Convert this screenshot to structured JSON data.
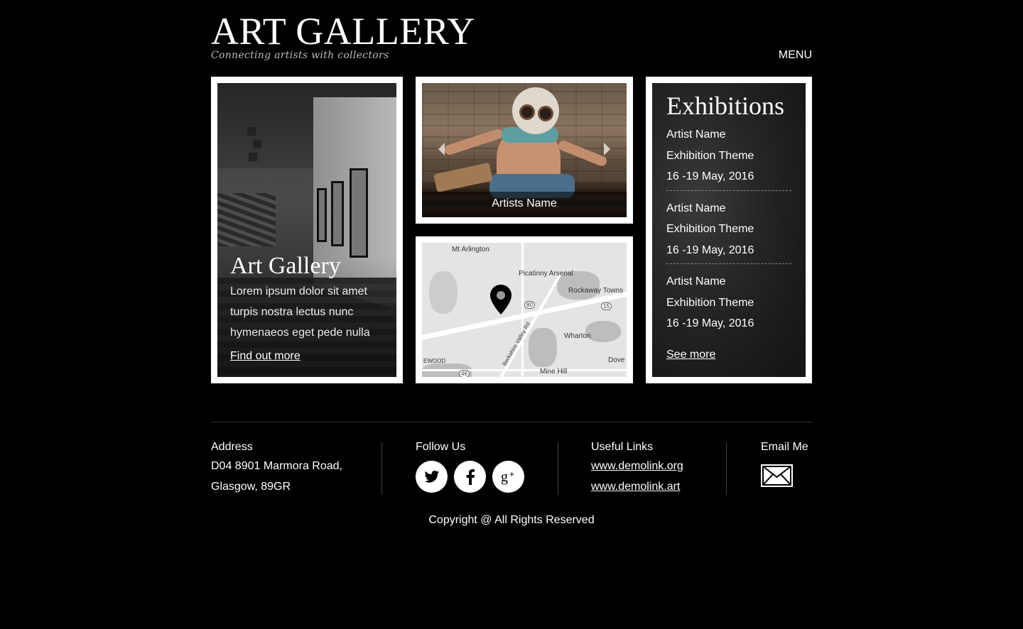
{
  "header": {
    "title": "ART GALLERY",
    "tagline": "Connecting artists with collectors",
    "menu_label": "MENU"
  },
  "gallery_card": {
    "title": "Art Gallery",
    "description": "Lorem ipsum dolor sit amet turpis nostra  lectus nunc hymenaeos eget pede nulla",
    "link_label": "Find out more"
  },
  "slider": {
    "caption": "Artists Name",
    "prev_icon": "chevron-left-icon",
    "next_icon": "chevron-right-icon"
  },
  "map": {
    "labels": {
      "mt_arlington": "Mt Arlington",
      "picatinny": "Picatinny Arsenal",
      "rockaway": "Rockaway Towns",
      "wharton": "Wharton",
      "berkshire": "Berkshire Valley Rd",
      "ewood": "EWOOD",
      "mine_hill": "Mine Hill",
      "dove": "Dove"
    },
    "shields": {
      "i80": "80",
      "r15": "15",
      "r46": "46"
    }
  },
  "exhibitions": {
    "title": "Exhibitions",
    "items": [
      {
        "artist": "Artist Name",
        "theme": "Exhibition Theme",
        "dates": "16 -19 May, 2016"
      },
      {
        "artist": "Artist Name",
        "theme": "Exhibition Theme",
        "dates": "16 -19 May, 2016"
      },
      {
        "artist": "Artist Name",
        "theme": "Exhibition Theme",
        "dates": "16 -19 May, 2016"
      }
    ],
    "more_label": "See more"
  },
  "footer": {
    "address": {
      "heading": "Address",
      "line1": "D04 8901 Marmora Road,",
      "line2": "Glasgow, 89GR"
    },
    "follow": {
      "heading": "Follow Us",
      "icons": [
        "twitter-icon",
        "facebook-icon",
        "google-plus-icon"
      ]
    },
    "links": {
      "heading": "Useful Links",
      "items": [
        "www.demolink.org",
        "www.demolink.art"
      ]
    },
    "email": {
      "heading": "Email Me",
      "icon": "envelope-icon"
    },
    "copyright": "Copyright @ All Rights Reserved"
  },
  "colors": {
    "background": "#000000",
    "text": "#ffffff",
    "card_border": "#ffffff"
  }
}
